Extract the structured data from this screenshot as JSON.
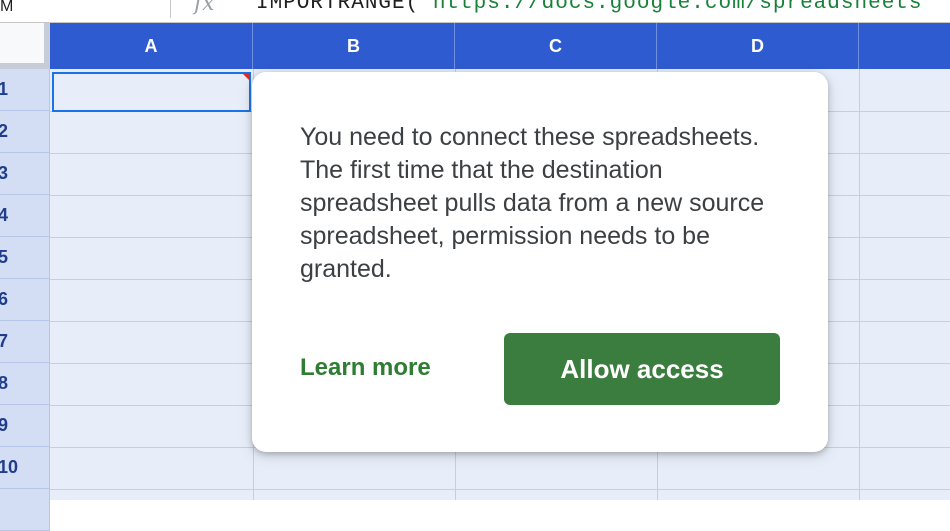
{
  "formula_bar": {
    "name_box": "M",
    "fx_icon": "fx-icon",
    "formula_function": "IMPORTRANGE(\"",
    "formula_argument": "https://docs.google.com/spreadsheets"
  },
  "sheet": {
    "columns": [
      "A",
      "B",
      "C",
      "D"
    ],
    "rows": [
      "1",
      "2",
      "3",
      "4",
      "5",
      "6",
      "7",
      "8",
      "9",
      "10"
    ],
    "header_color": "#2f5bd0",
    "selected_cell": "A1"
  },
  "popup": {
    "message": "You need to connect these spreadsheets. The first time that the destination spreadsheet pulls data from a new source spreadsheet, permission needs to be granted.",
    "learn_more_label": "Learn more",
    "allow_access_label": "Allow access",
    "accent_color": "#3b7d3f"
  }
}
